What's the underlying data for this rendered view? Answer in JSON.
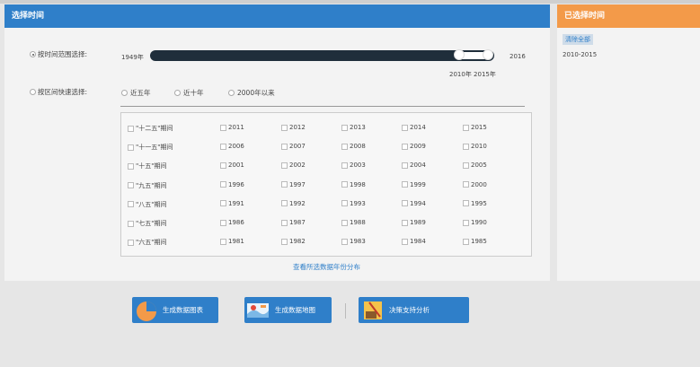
{
  "main": {
    "title": "选择时间",
    "range_label": "按时间范围选择:",
    "slider": {
      "min_label": "1949年",
      "max_label": "2016",
      "selected_label": "2010年  2015年",
      "selected_start": 2010,
      "selected_end": 2015
    },
    "quick_label": "按区间快速选择:",
    "quick_options": [
      "近五年",
      "近十年",
      "2000年以来"
    ],
    "periods": [
      {
        "label": "\"十二五\"期间",
        "years": [
          "2011",
          "2012",
          "2013",
          "2014",
          "2015"
        ]
      },
      {
        "label": "\"十一五\"期间",
        "years": [
          "2006",
          "2007",
          "2008",
          "2009",
          "2010"
        ]
      },
      {
        "label": "\"十五\"期间",
        "years": [
          "2001",
          "2002",
          "2003",
          "2004",
          "2005"
        ]
      },
      {
        "label": "\"九五\"期间",
        "years": [
          "1996",
          "1997",
          "1998",
          "1999",
          "2000"
        ]
      },
      {
        "label": "\"八五\"期间",
        "years": [
          "1991",
          "1992",
          "1993",
          "1994",
          "1995"
        ]
      },
      {
        "label": "\"七五\"期间",
        "years": [
          "1986",
          "1987",
          "1988",
          "1989",
          "1990"
        ]
      },
      {
        "label": "\"六五\"期间",
        "years": [
          "1981",
          "1982",
          "1983",
          "1984",
          "1985"
        ]
      }
    ],
    "view_link": "查看所选数据年份分布"
  },
  "right": {
    "title": "已选择时间",
    "clear_label": "清除全部",
    "selected_range": "2010-2015"
  },
  "bottom": {
    "buttons": [
      {
        "label": "生成数据图表",
        "icon": "pie-chart-icon"
      },
      {
        "label": "生成数据地图",
        "icon": "map-icon"
      },
      {
        "label": "决策支持分析",
        "icon": "decision-icon"
      }
    ]
  },
  "colors": {
    "header_blue": "#2f7fc9",
    "header_orange": "#f39a49",
    "slider_dark": "#1f2e3b"
  }
}
